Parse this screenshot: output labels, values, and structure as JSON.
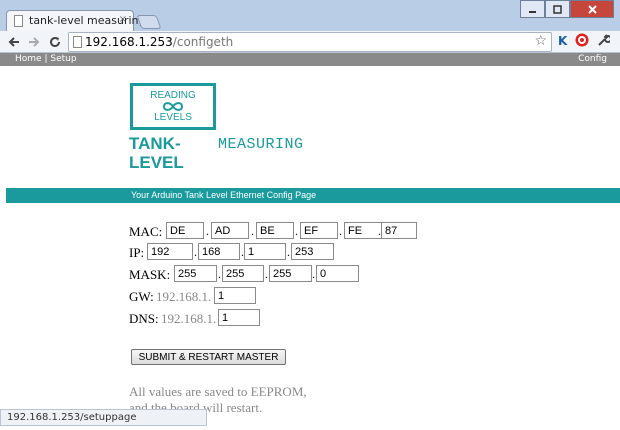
{
  "browser": {
    "tab_title": "tank-level measuring",
    "tab_close": "×",
    "url_host": "192.168.1.253",
    "url_path": "/configeth",
    "ext_k": "K"
  },
  "menubar": {
    "home": "Home",
    "separator": "|",
    "setup": "Setup",
    "config": "Config"
  },
  "logo": {
    "line1": "READING",
    "line2": "LEVELS"
  },
  "brand": {
    "tank": "TANK-",
    "level": "LEVEL",
    "measuring": "MEASURING"
  },
  "banner": "Your Arduino Tank Level Ethernet Config Page",
  "form": {
    "mac_label": "MAC:",
    "mac": [
      "DE",
      "AD",
      "BE",
      "EF",
      "FE",
      "87"
    ],
    "ip_label": "IP:",
    "ip": [
      "192",
      "168",
      "1",
      "253"
    ],
    "mask_label": "MASK:",
    "mask": [
      "255",
      "255",
      "255",
      "0"
    ],
    "gw_label": "GW:",
    "gw_prefix": "192.168.1.",
    "gw": "1",
    "dns_label": "DNS:",
    "dns_prefix": "192.168.1.",
    "dns": "1",
    "dot": "."
  },
  "submit_label": "SUBMIT & RESTART MASTER",
  "note": {
    "line1": "All values are saved to EEPROM,",
    "line2": "and the board will restart."
  },
  "statusbar": "192.168.1.253/setuppage",
  "colors": {
    "accent": "#1a9a9d",
    "menubar": "#8a8a8a"
  }
}
